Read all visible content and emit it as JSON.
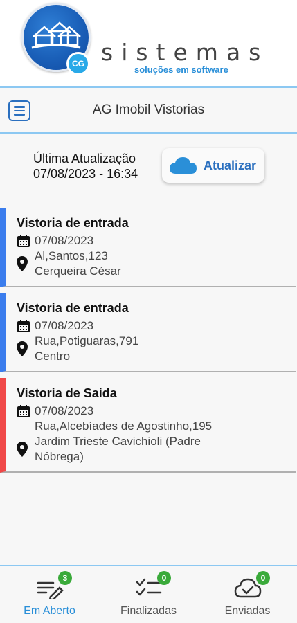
{
  "brand": {
    "name": "sistemas",
    "tagline": "soluções em software",
    "badge_text": "CG"
  },
  "header": {
    "title": "AG Imobil Vistorias"
  },
  "update": {
    "label_line1": "Última Atualização",
    "label_line2": "07/08/2023 - 16:34",
    "button_label": "Atualizar"
  },
  "inspections": [
    {
      "title": "Vistoria de entrada",
      "date": "07/08/2023",
      "address_line1": "Al,Santos,123",
      "address_line2": "Cerqueira César",
      "address_line3": "",
      "type": "entrada",
      "accent": "#3b7ded"
    },
    {
      "title": "Vistoria de entrada",
      "date": "07/08/2023",
      "address_line1": "Rua,Potiguaras,791",
      "address_line2": "Centro",
      "address_line3": "",
      "type": "entrada",
      "accent": "#3b7ded"
    },
    {
      "title": "Vistoria de Saida",
      "date": "07/08/2023",
      "address_line1": "Rua,Alcebíades de Agostinho,195",
      "address_line2": "Jardim Trieste Cavichioli (Padre",
      "address_line3": "Nóbrega)",
      "type": "saida",
      "accent": "#f04848"
    }
  ],
  "bottom_nav": {
    "tabs": [
      {
        "label": "Em Aberto",
        "count": "3",
        "icon": "edit-list-icon",
        "active": true
      },
      {
        "label": "Finalizadas",
        "count": "0",
        "icon": "checklist-icon",
        "active": false
      },
      {
        "label": "Enviadas",
        "count": "0",
        "icon": "cloud-check-icon",
        "active": false
      }
    ]
  },
  "colors": {
    "accent": "#2a6fbf",
    "entry": "#3b7ded",
    "exit": "#f04848",
    "badge": "#3aaa3a",
    "active_tab": "#2a8fd8"
  }
}
